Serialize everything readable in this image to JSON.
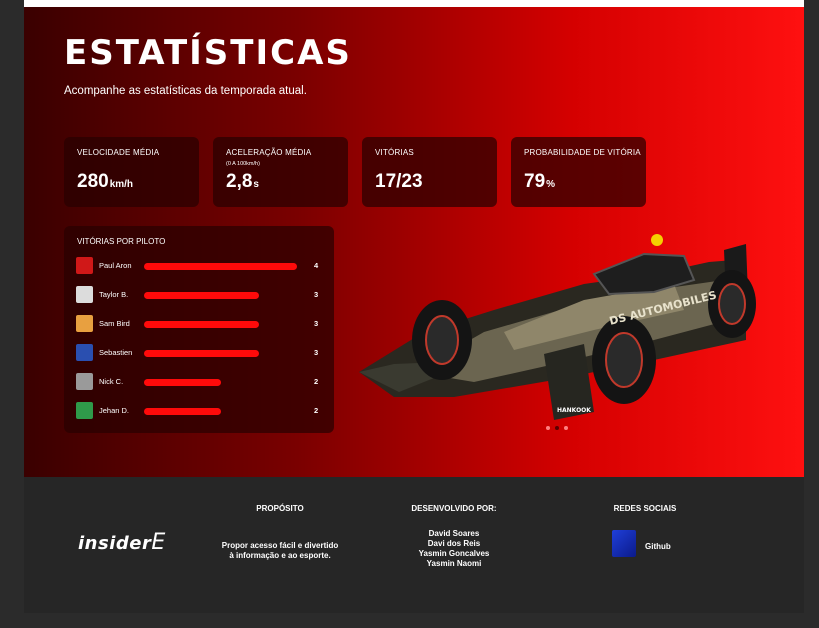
{
  "page": {
    "title": "ESTATÍSTICAS",
    "subtitle": "Acompanhe as estatísticas da temporada atual."
  },
  "stats": [
    {
      "label": "VELOCIDADE MÉDIA",
      "sub": "",
      "value": "280",
      "unit": "km/h"
    },
    {
      "label": "ACELERAÇÃO MÉDIA",
      "sub": "(0 A 100km/h)",
      "value": "2,8",
      "unit": "s"
    },
    {
      "label": "VITÓRIAS",
      "sub": "",
      "value": "17/23",
      "unit": ""
    },
    {
      "label": "PROBABILIDADE DE VITÓRIA",
      "sub": "",
      "value": "79",
      "unit": "%"
    }
  ],
  "winners": {
    "title": "VITÓRIAS POR PILOTO",
    "max": 4,
    "drivers": [
      {
        "name": "Paul Aron",
        "wins": 4,
        "avatar_color": "#d01818"
      },
      {
        "name": "Taylor B.",
        "wins": 3,
        "avatar_color": "#dcdcdc"
      },
      {
        "name": "Sam Bird",
        "wins": 3,
        "avatar_color": "#e8a040"
      },
      {
        "name": "Sebastien",
        "wins": 3,
        "avatar_color": "#2a4fb0"
      },
      {
        "name": "Nick C.",
        "wins": 2,
        "avatar_color": "#9a9a9a"
      },
      {
        "name": "Jehan D.",
        "wins": 2,
        "avatar_color": "#2f9a4a"
      }
    ]
  },
  "car": {
    "livery_text": "DS AUTOMOBILES",
    "sponsor_text": "HANKOOK"
  },
  "carousel": {
    "count": 3,
    "active": 1
  },
  "footer": {
    "logo_text": "insider",
    "logo_letter": "E",
    "purpose_title": "PROPÓSITO",
    "purpose_text": [
      "Propor acesso fácil e divertido",
      "à informação e ao esporte."
    ],
    "dev_title": "DESENVOLVIDO POR:",
    "developers": [
      "David Soares",
      "Davi dos Reis",
      "Yasmin Goncalves",
      "Yasmin Naomi"
    ],
    "social_title": "REDES SOCIAIS",
    "github_label": "Github"
  },
  "colors": {
    "accent": "#ff0a0a",
    "card_bg": "#280000",
    "footer_bg": "#262626",
    "page_bg": "#2b2b2b"
  }
}
